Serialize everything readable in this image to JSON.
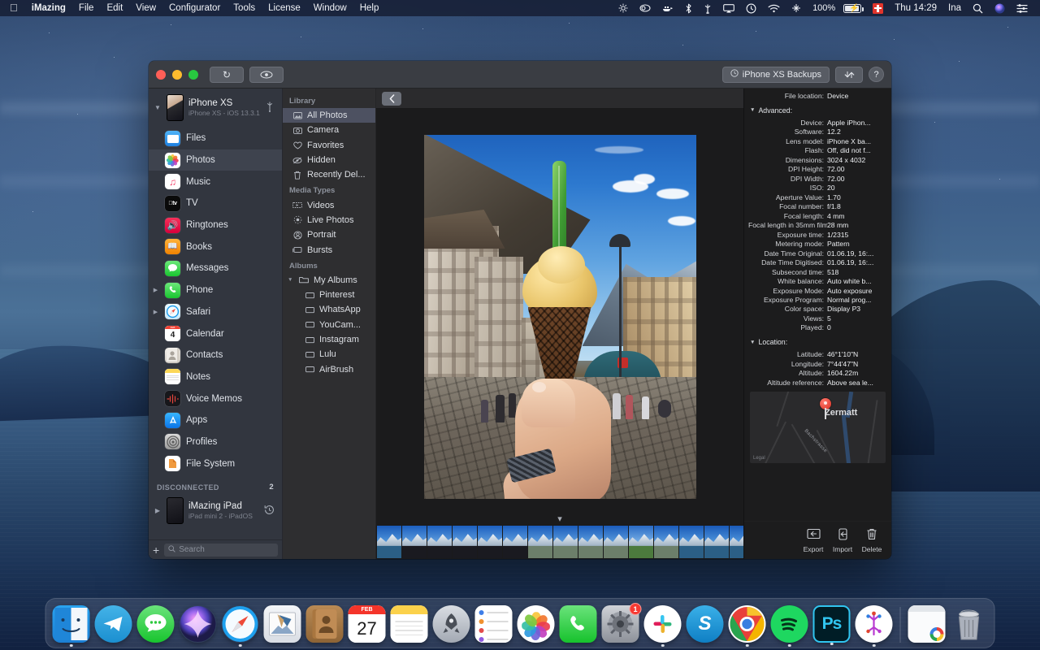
{
  "menubar": {
    "apple_icon": "apple-logo",
    "items": [
      {
        "label": "iMazing",
        "bold": true
      },
      {
        "label": "File",
        "bold": false
      },
      {
        "label": "Edit",
        "bold": false
      },
      {
        "label": "View",
        "bold": false
      },
      {
        "label": "Configurator",
        "bold": false
      },
      {
        "label": "Tools",
        "bold": false
      },
      {
        "label": "License",
        "bold": false
      },
      {
        "label": "Window",
        "bold": false
      },
      {
        "label": "Help",
        "bold": false
      }
    ],
    "status_icons": [
      {
        "name": "location-services-icon",
        "glyph": "✵"
      },
      {
        "name": "adobe-creative-cloud-icon",
        "glyph": "◎"
      },
      {
        "name": "docker-icon",
        "glyph": "⚓"
      },
      {
        "name": "bluetooth-icon",
        "glyph": "ᛦ"
      },
      {
        "name": "usb-device-icon",
        "glyph": "Ψ"
      },
      {
        "name": "airplay-icon",
        "glyph": "▭"
      },
      {
        "name": "time-machine-icon",
        "glyph": "↺"
      },
      {
        "name": "wifi-icon",
        "glyph": "◠"
      },
      {
        "name": "vpn-icon",
        "glyph": "✥"
      }
    ],
    "battery_percent": "100%",
    "keyboard_flag": "swiss-flag",
    "clock": "Thu 14:29",
    "user": "Ina",
    "search_icon": "search-icon",
    "siri_icon": "siri-icon",
    "control_center_icon": "control-center-icon"
  },
  "window": {
    "titlebar": {
      "refresh_icon": "refresh-icon",
      "preview_icon": "eye-icon",
      "backups_label": "iPhone XS Backups",
      "backups_icon": "history-clock-icon",
      "transfer_icon": "transfer-arrows-icon",
      "help_label": "?"
    },
    "sidebar": {
      "device": {
        "name": "iPhone XS",
        "subtitle": "iPhone XS - iOS 13.3.1",
        "connection_icon": "usb-icon",
        "disclosure_icon": "chevron-down-icon"
      },
      "items": [
        {
          "label": "Files",
          "icon": "files-icon",
          "expandable": false,
          "selected": false
        },
        {
          "label": "Photos",
          "icon": "photos-icon",
          "expandable": false,
          "selected": true
        },
        {
          "label": "Music",
          "icon": "music-icon",
          "expandable": false,
          "selected": false
        },
        {
          "label": "TV",
          "icon": "tv-icon",
          "expandable": false,
          "selected": false
        },
        {
          "label": "Ringtones",
          "icon": "ringtones-icon",
          "expandable": false,
          "selected": false
        },
        {
          "label": "Books",
          "icon": "books-icon",
          "expandable": false,
          "selected": false
        },
        {
          "label": "Messages",
          "icon": "messages-icon",
          "expandable": false,
          "selected": false
        },
        {
          "label": "Phone",
          "icon": "phone-icon",
          "expandable": true,
          "selected": false
        },
        {
          "label": "Safari",
          "icon": "safari-icon",
          "expandable": true,
          "selected": false
        },
        {
          "label": "Calendar",
          "icon": "calendar-icon",
          "expandable": false,
          "selected": false
        },
        {
          "label": "Contacts",
          "icon": "contacts-icon",
          "expandable": false,
          "selected": false
        },
        {
          "label": "Notes",
          "icon": "notes-icon",
          "expandable": false,
          "selected": false
        },
        {
          "label": "Voice Memos",
          "icon": "voice-memos-icon",
          "expandable": false,
          "selected": false
        },
        {
          "label": "Apps",
          "icon": "apps-icon",
          "expandable": false,
          "selected": false
        },
        {
          "label": "Profiles",
          "icon": "profiles-icon",
          "expandable": false,
          "selected": false
        },
        {
          "label": "File System",
          "icon": "file-system-icon",
          "expandable": false,
          "selected": false
        }
      ],
      "disconnected_header": "DISCONNECTED",
      "disconnected_count": "2",
      "disconnected_device": {
        "name": "iMazing iPad",
        "subtitle": "iPad mini 2 - iPadOS ",
        "history_icon": "history-clock-icon",
        "disclosure_icon": "chevron-right-icon"
      },
      "add_label": "+",
      "search_placeholder": "Search",
      "search_icon": "search-icon"
    },
    "library": {
      "sections": [
        {
          "header": "Library",
          "items": [
            {
              "label": "All Photos",
              "icon": "photo-stack-icon",
              "selected": true
            },
            {
              "label": "Camera",
              "icon": "camera-icon",
              "selected": false
            },
            {
              "label": "Favorites",
              "icon": "heart-icon",
              "selected": false
            },
            {
              "label": "Hidden",
              "icon": "eye-slash-icon",
              "selected": false
            },
            {
              "label": "Recently Del...",
              "icon": "trash-icon",
              "selected": false
            }
          ]
        },
        {
          "header": "Media Types",
          "items": [
            {
              "label": "Videos",
              "icon": "video-icon",
              "selected": false
            },
            {
              "label": "Live Photos",
              "icon": "live-photo-icon",
              "selected": false
            },
            {
              "label": "Portrait",
              "icon": "portrait-icon",
              "selected": false
            },
            {
              "label": "Bursts",
              "icon": "bursts-icon",
              "selected": false
            }
          ]
        },
        {
          "header": "Albums",
          "group": {
            "label": "My Albums",
            "icon": "folder-icon",
            "disclosure_icon": "chevron-down-icon"
          },
          "items": [
            {
              "label": "Pinterest",
              "icon": "album-icon",
              "selected": false
            },
            {
              "label": "WhatsApp",
              "icon": "album-icon",
              "selected": false
            },
            {
              "label": "YouCam...",
              "icon": "album-icon",
              "selected": false
            },
            {
              "label": "Instagram",
              "icon": "album-icon",
              "selected": false
            },
            {
              "label": "Lulu",
              "icon": "album-icon",
              "selected": false
            },
            {
              "label": "AirBrush",
              "icon": "album-icon",
              "selected": false
            }
          ]
        }
      ]
    },
    "viewer": {
      "back_icon": "chevron-left-icon",
      "collapse_icon": "chevron-down-icon",
      "photo_description": "Ice cream cone held up in a Swiss alpine village street"
    },
    "info": {
      "top_rows": [
        {
          "key": "File location:",
          "value": "Device"
        }
      ],
      "advanced": {
        "section_label": "Advanced:",
        "disclosure_icon": "chevron-down-icon",
        "rows": [
          {
            "key": "Device:",
            "value": "Apple iPhon..."
          },
          {
            "key": "Software:",
            "value": "12.2"
          },
          {
            "key": "Lens model:",
            "value": "iPhone X ba..."
          },
          {
            "key": "Flash:",
            "value": "Off, did not f..."
          },
          {
            "key": "Dimensions:",
            "value": "3024 x 4032"
          },
          {
            "key": "DPI Height:",
            "value": "72.00"
          },
          {
            "key": "DPI Width:",
            "value": "72.00"
          },
          {
            "key": "ISO:",
            "value": "20"
          },
          {
            "key": "Aperture Value:",
            "value": "1.70"
          },
          {
            "key": "Focal number:",
            "value": "f/1.8"
          },
          {
            "key": "Focal length:",
            "value": "4 mm"
          },
          {
            "key": "Focal length in 35mm film:",
            "value": "28 mm"
          },
          {
            "key": "Exposure time:",
            "value": "1/2315"
          },
          {
            "key": "Metering mode:",
            "value": "Pattern"
          },
          {
            "key": "Date Time Original:",
            "value": "01.06.19, 16:..."
          },
          {
            "key": "Date Time Digitised:",
            "value": "01.06.19, 16:..."
          },
          {
            "key": "Subsecond time:",
            "value": "518"
          },
          {
            "key": "White balance:",
            "value": "Auto white b..."
          },
          {
            "key": "Exposure Mode:",
            "value": "Auto exposure"
          },
          {
            "key": "Exposure Program:",
            "value": "Normal prog..."
          },
          {
            "key": "Color space:",
            "value": "Display P3"
          },
          {
            "key": "Views:",
            "value": "5"
          },
          {
            "key": "Played:",
            "value": "0"
          }
        ]
      },
      "location": {
        "section_label": "Location:",
        "disclosure_icon": "chevron-down-icon",
        "rows": [
          {
            "key": "Latitude:",
            "value": "46°1'10\"N"
          },
          {
            "key": "Longitude:",
            "value": "7°44'47\"N"
          },
          {
            "key": "Altitude:",
            "value": "1604.22m"
          },
          {
            "key": "Altitude reference:",
            "value": "Above sea le..."
          }
        ],
        "map": {
          "place_label": "Zermatt",
          "street_label": "Bachstrasse",
          "legal_label": "Legal",
          "pin_icon": "map-pin-icon"
        }
      },
      "actions": [
        {
          "label": "Export",
          "icon": "export-icon"
        },
        {
          "label": "Import",
          "icon": "import-icon"
        },
        {
          "label": "Delete",
          "icon": "trash-icon"
        }
      ]
    }
  },
  "dock": {
    "items": [
      {
        "name": "finder",
        "label": "Finder",
        "running": true
      },
      {
        "name": "telegram",
        "label": "Telegram",
        "running": false
      },
      {
        "name": "messages",
        "label": "Messages",
        "running": false
      },
      {
        "name": "siri",
        "label": "Siri",
        "running": false
      },
      {
        "name": "safari",
        "label": "Safari",
        "running": true
      },
      {
        "name": "mail",
        "label": "Mail",
        "running": false
      },
      {
        "name": "contacts",
        "label": "Contacts",
        "running": false
      },
      {
        "name": "calendar",
        "label": "Calendar",
        "running": false,
        "day": "27",
        "month": "FEB"
      },
      {
        "name": "notes",
        "label": "Notes",
        "running": false
      },
      {
        "name": "launchpad",
        "label": "Launchpad",
        "running": false
      },
      {
        "name": "reminders",
        "label": "Reminders",
        "running": false
      },
      {
        "name": "photos",
        "label": "Photos",
        "running": false
      },
      {
        "name": "facetime",
        "label": "FaceTime",
        "running": false
      },
      {
        "name": "system-preferences",
        "label": "System Preferences",
        "running": false,
        "badge": "1"
      },
      {
        "name": "slack",
        "label": "Slack",
        "running": true
      },
      {
        "name": "skype",
        "label": "Skype",
        "running": false
      },
      {
        "name": "chrome",
        "label": "Google Chrome",
        "running": true
      },
      {
        "name": "spotify",
        "label": "Spotify",
        "running": true
      },
      {
        "name": "photoshop",
        "label": "Adobe Photoshop",
        "running": true
      },
      {
        "name": "imazing",
        "label": "iMazing",
        "running": true
      }
    ],
    "extras": [
      {
        "name": "downloads-stack",
        "label": "Downloads"
      },
      {
        "name": "trash",
        "label": "Trash"
      }
    ]
  }
}
